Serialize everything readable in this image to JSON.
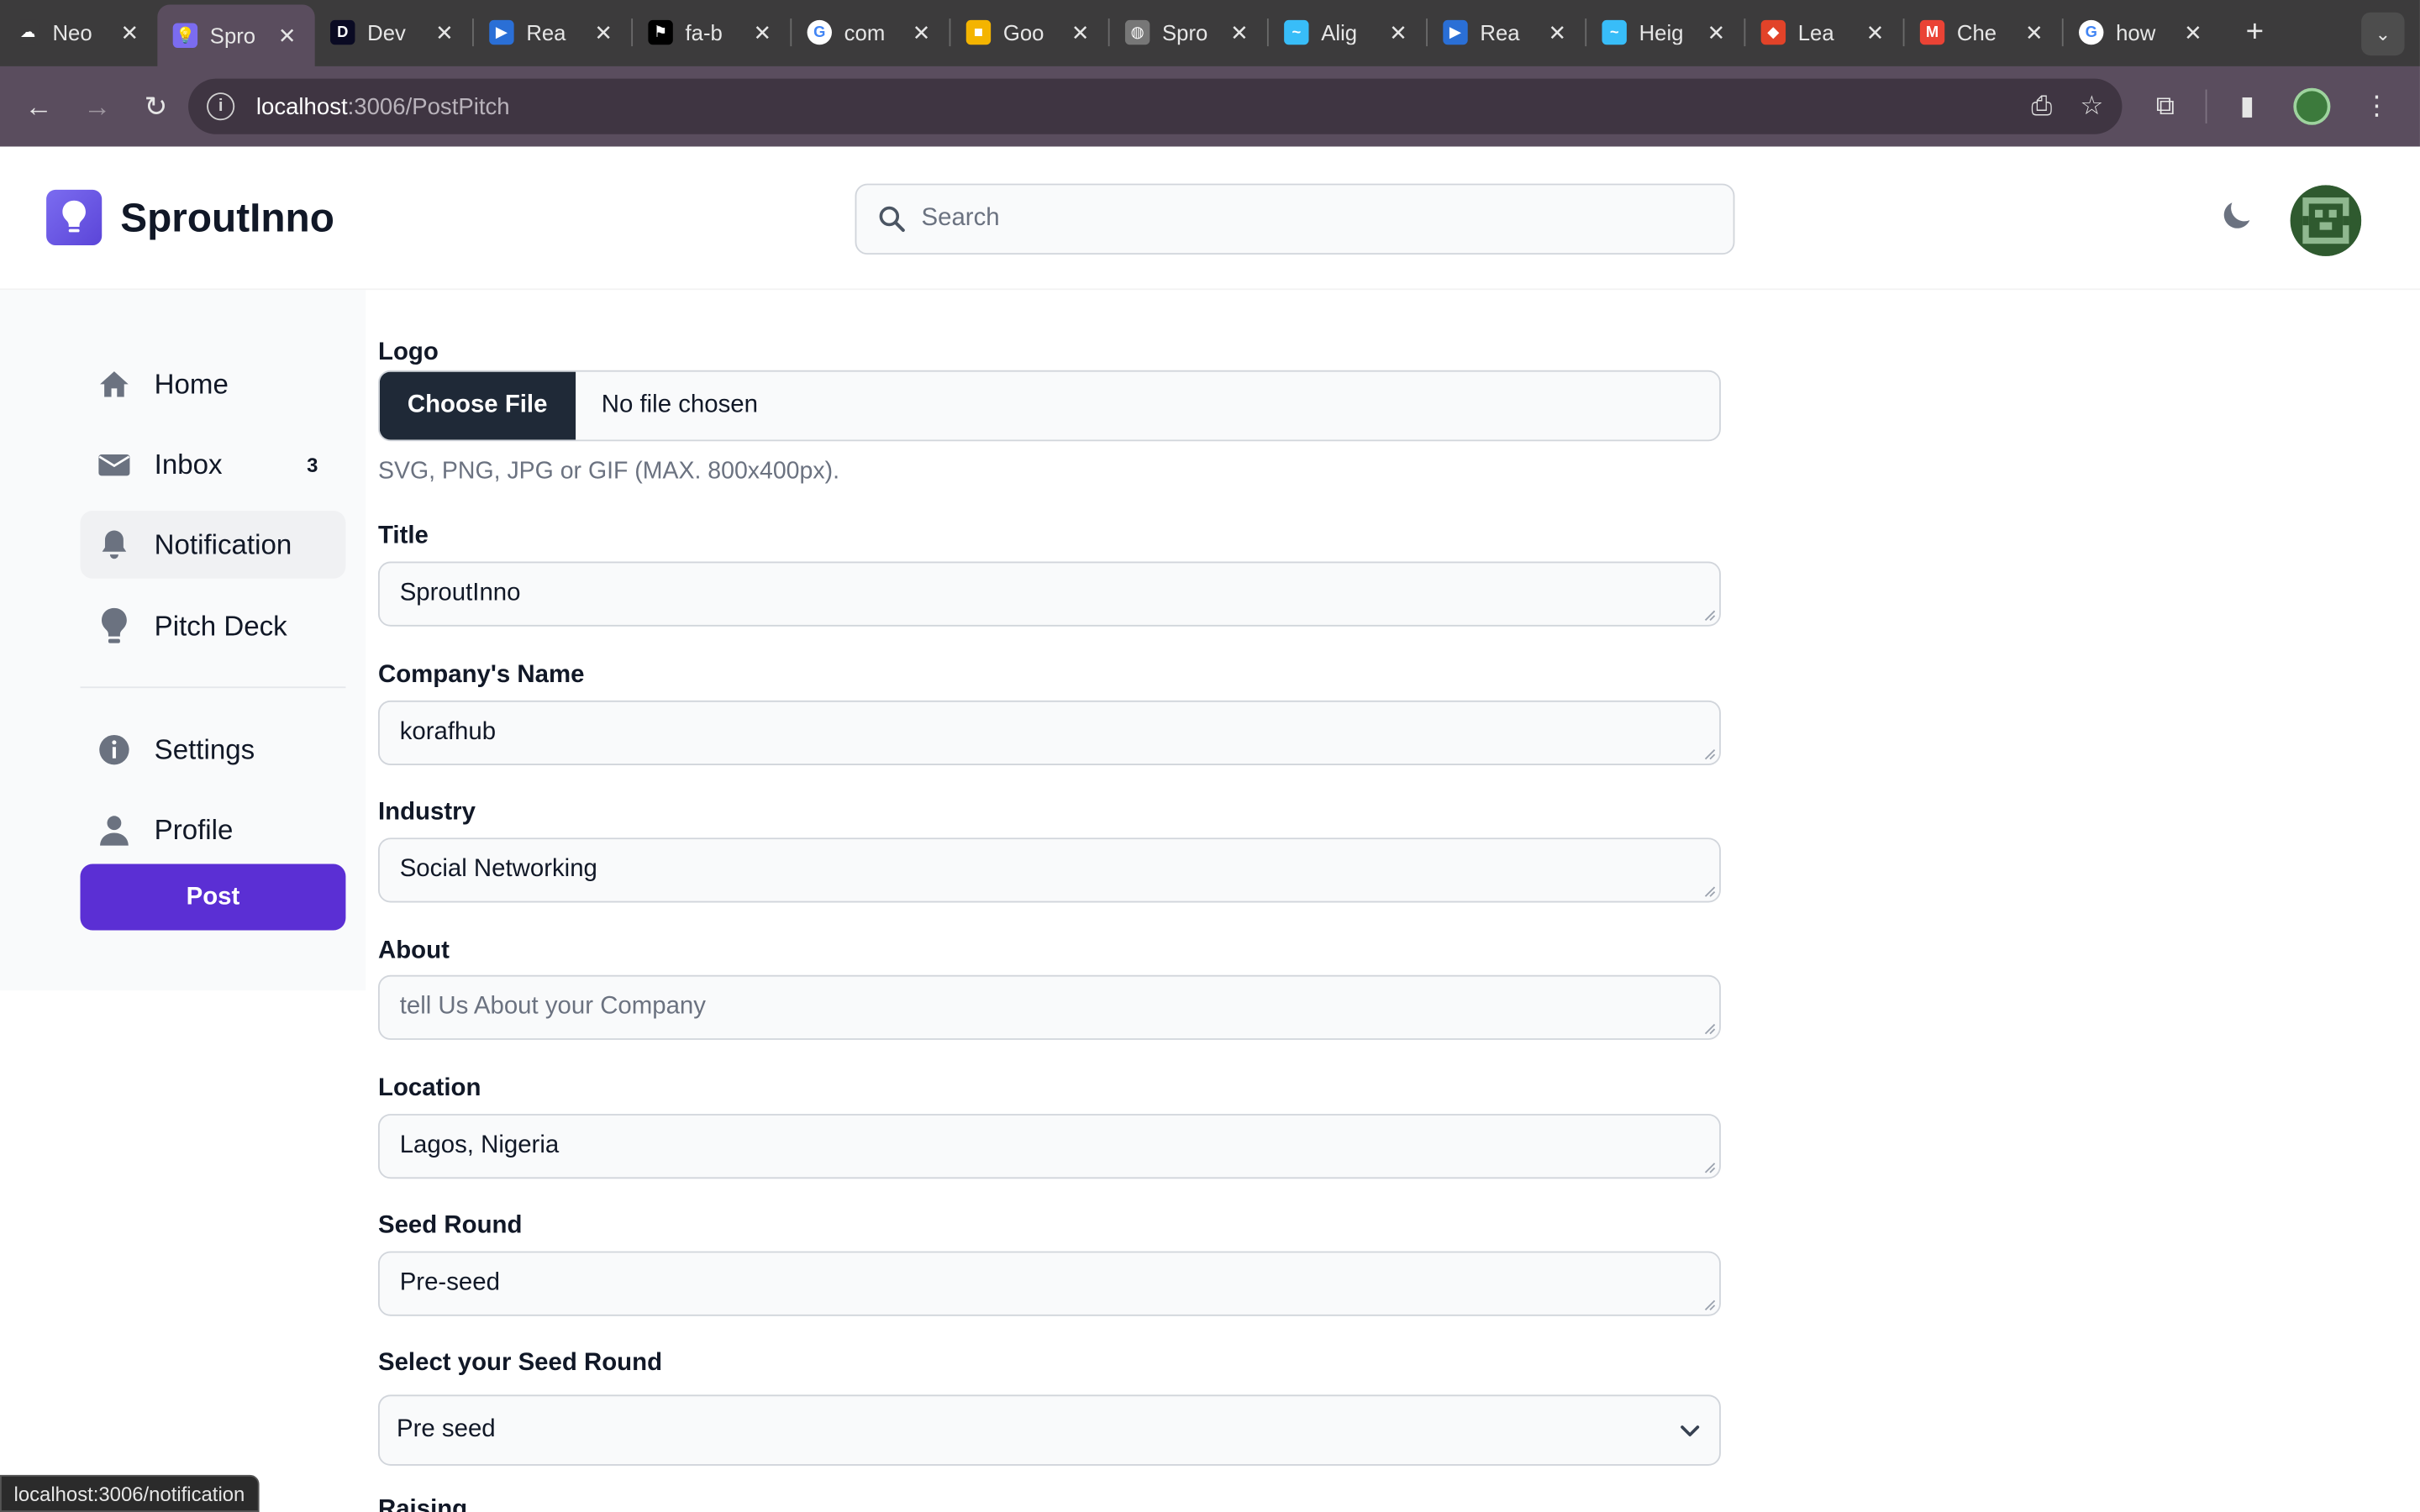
{
  "browser": {
    "tabs": [
      {
        "title": "Neo",
        "fav_color": "#3c3b3c",
        "fav_glyph": "☁"
      },
      {
        "title": "Spro",
        "fav_color": "#7b6cf0",
        "fav_glyph": "💡",
        "active": true
      },
      {
        "title": "Dev",
        "fav_color": "#0a0a23",
        "fav_glyph": "D"
      },
      {
        "title": "Rea",
        "fav_color": "#2a6fd6",
        "fav_glyph": "▶"
      },
      {
        "title": "fa-b",
        "fav_color": "#000000",
        "fav_glyph": "⚑"
      },
      {
        "title": "com",
        "fav_color": "#ffffff",
        "fav_glyph": "G"
      },
      {
        "title": "Goo",
        "fav_color": "#f4b400",
        "fav_glyph": "■"
      },
      {
        "title": "Spro",
        "fav_color": "#777777",
        "fav_glyph": "◍"
      },
      {
        "title": "Alig",
        "fav_color": "#38bdf8",
        "fav_glyph": "~"
      },
      {
        "title": "Rea",
        "fav_color": "#2a6fd6",
        "fav_glyph": "▶"
      },
      {
        "title": "Heig",
        "fav_color": "#38bdf8",
        "fav_glyph": "~"
      },
      {
        "title": "Lea",
        "fav_color": "#e24329",
        "fav_glyph": "◆"
      },
      {
        "title": "Che",
        "fav_color": "#ea4335",
        "fav_glyph": "M"
      },
      {
        "title": "how",
        "fav_color": "#ffffff",
        "fav_glyph": "G"
      }
    ],
    "url_host": "localhost",
    "url_path": ":3006/PostPitch",
    "status_url": "localhost:3006/notification"
  },
  "header": {
    "brand": "SproutInno",
    "search_placeholder": "Search"
  },
  "sidebar": {
    "items": [
      {
        "label": "Home",
        "icon": "home-icon"
      },
      {
        "label": "Inbox",
        "icon": "mail-icon",
        "count": "3"
      },
      {
        "label": "Notification",
        "icon": "bell-icon"
      },
      {
        "label": "Pitch Deck",
        "icon": "lightbulb-icon"
      },
      {
        "label": "Settings",
        "icon": "info-icon"
      },
      {
        "label": "Profile",
        "icon": "user-icon"
      }
    ],
    "post_label": "Post"
  },
  "form": {
    "logo_label": "Logo",
    "choose_file": "Choose File",
    "no_file": "No file chosen",
    "logo_hint": "SVG, PNG, JPG or GIF (MAX. 800x400px).",
    "title_label": "Title",
    "title_value": "SproutInno",
    "company_label": "Company's Name",
    "company_value": "korafhub",
    "industry_label": "Industry",
    "industry_value": "Social Networking",
    "about_label": "About",
    "about_placeholder": "tell Us About your Company",
    "location_label": "Location",
    "location_value": "Lagos, Nigeria",
    "seed_label": "Seed Round",
    "seed_value": "Pre-seed",
    "select_seed_label": "Select your Seed Round",
    "select_seed_value": "Pre seed",
    "raising_label": "Raising"
  },
  "colors": {
    "accent": "#5b2fd4",
    "file_button": "#1f2937"
  }
}
